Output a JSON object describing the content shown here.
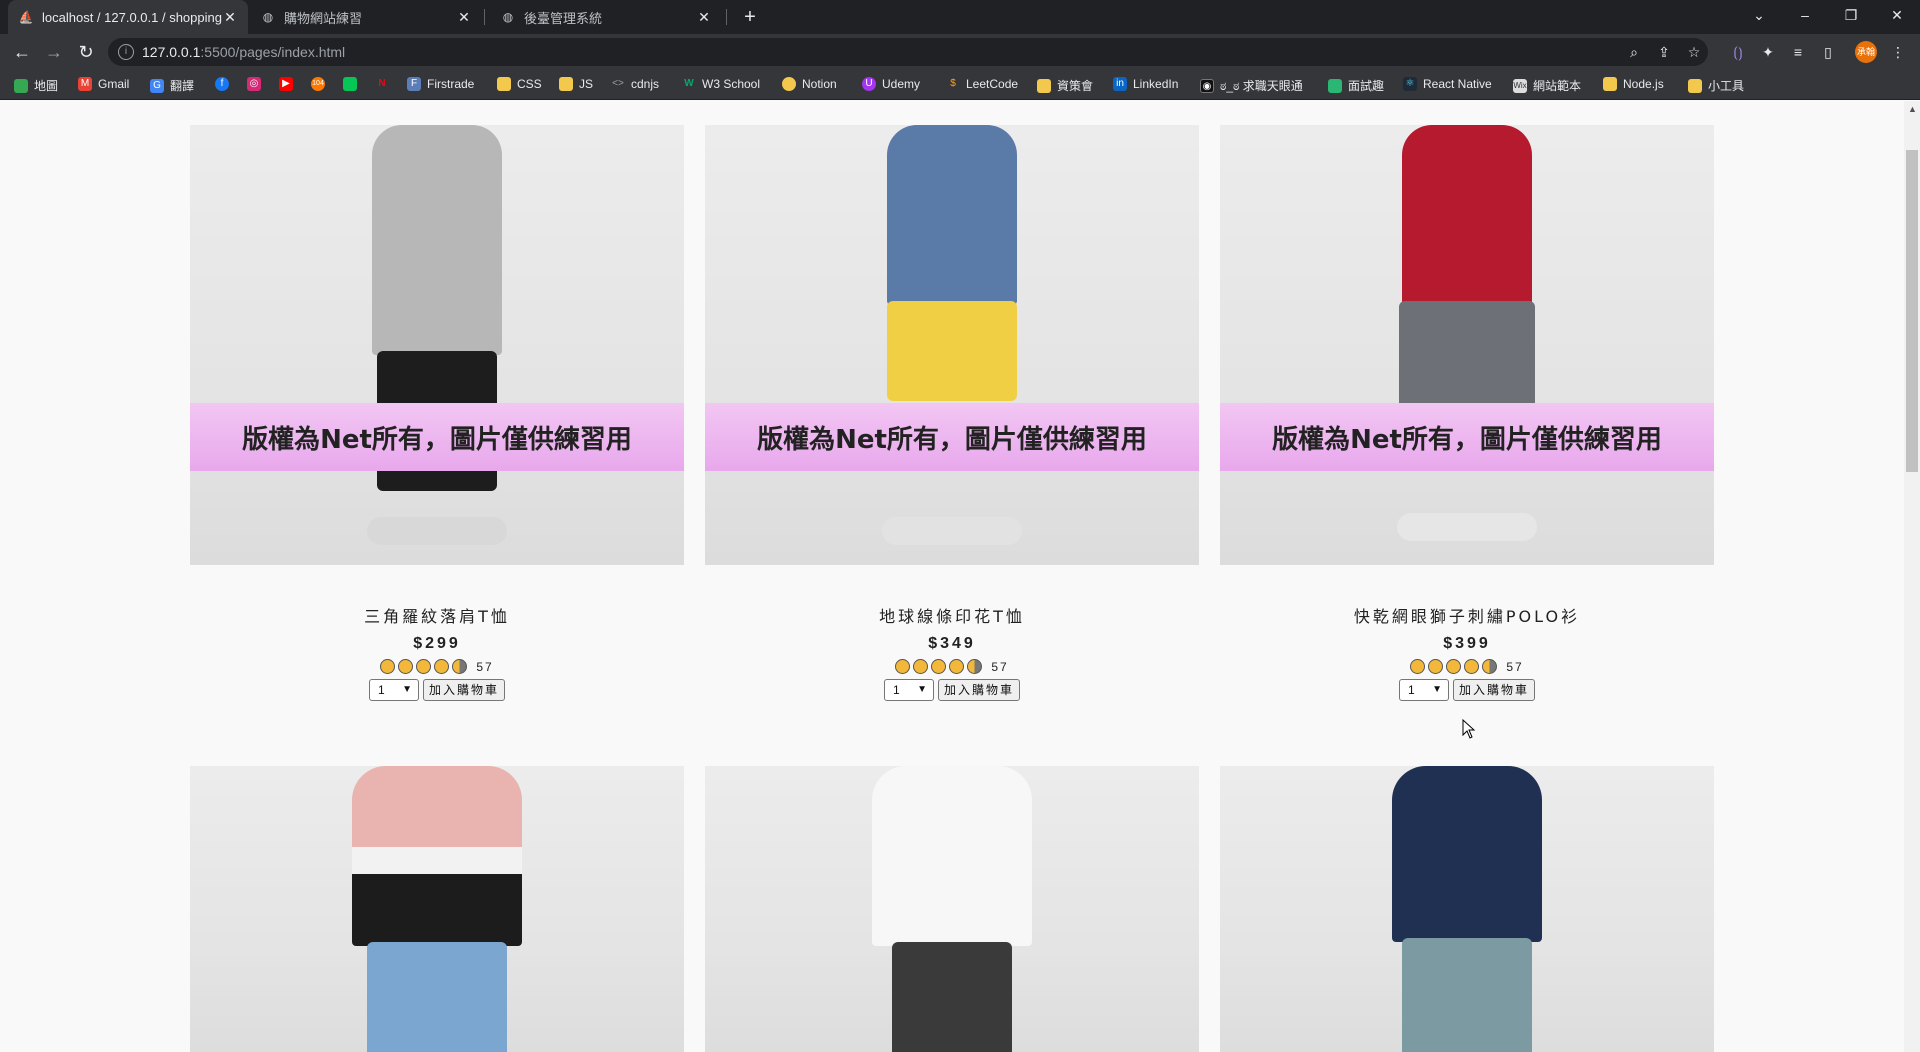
{
  "browser": {
    "tabs": [
      {
        "title": "localhost / 127.0.0.1 / shopping",
        "active": true
      },
      {
        "title": "購物網站練習",
        "active": false
      },
      {
        "title": "後臺管理系統",
        "active": false
      }
    ],
    "close_glyph": "✕",
    "new_tab_glyph": "+",
    "url_host": "127.0.0.1",
    "url_path": ":5500/pages/index.html",
    "profile_label": "承翰"
  },
  "bookmarks": [
    {
      "label": "地圖",
      "icon": "maps-icon",
      "color": "#34a853"
    },
    {
      "label": "Gmail",
      "icon": "gmail-icon",
      "color": "#ea4335"
    },
    {
      "label": "翻譯",
      "icon": "translate-icon",
      "color": "#4285f4"
    },
    {
      "label": "",
      "icon": "facebook-icon",
      "color": "#1877f2"
    },
    {
      "label": "",
      "icon": "instagram-icon",
      "color": "#d62976"
    },
    {
      "label": "",
      "icon": "youtube-icon",
      "color": "#ff0000"
    },
    {
      "label": "",
      "icon": "104-icon",
      "color": "#ff7800"
    },
    {
      "label": "",
      "icon": "line-icon",
      "color": "#06c755"
    },
    {
      "label": "",
      "icon": "netflix-icon",
      "color": "#e50914"
    },
    {
      "label": "Firstrade",
      "icon": "firstrade-icon",
      "color": "#5b7db8"
    },
    {
      "label": "CSS",
      "icon": "folder-icon",
      "color": "#f2c94c"
    },
    {
      "label": "JS",
      "icon": "folder-icon",
      "color": "#f2c94c"
    },
    {
      "label": "cdnjs",
      "icon": "code-icon",
      "color": "#9aa0a6"
    },
    {
      "label": "W3 School",
      "icon": "w3-icon",
      "color": "#04aa6d"
    },
    {
      "label": "Notion",
      "icon": "notion-icon",
      "color": "#f2c94c"
    },
    {
      "label": "Udemy",
      "icon": "udemy-icon",
      "color": "#a435f0"
    },
    {
      "label": "LeetCode",
      "icon": "leetcode-icon",
      "color": "#ffa116"
    },
    {
      "label": "資策會",
      "icon": "folder-icon",
      "color": "#f2c94c"
    },
    {
      "label": "LinkedIn",
      "icon": "linkedin-icon",
      "color": "#0a66c2"
    },
    {
      "label": "ಠ_ಠ 求職天眼通",
      "icon": "eye-icon",
      "color": "#333333"
    },
    {
      "label": "面試趣",
      "icon": "interview-icon",
      "color": "#2bb673"
    },
    {
      "label": "React Native",
      "icon": "react-icon",
      "color": "#61dafb"
    },
    {
      "label": "網站範本",
      "icon": "template-icon",
      "color": "#555555"
    },
    {
      "label": "Node.js",
      "icon": "folder-icon",
      "color": "#f2c94c"
    },
    {
      "label": "小工具",
      "icon": "folder-icon",
      "color": "#f2c94c"
    }
  ],
  "products": [
    {
      "name": "三角羅紋落肩T恤",
      "price": "$299",
      "rating": 4.5,
      "reviews": "57",
      "qty": "1",
      "button": "加入購物車",
      "banner": "版權為Net所有，圖片僅供練習用",
      "shirt_color": "#b7b7b7",
      "bottom_color": "#1d1d1d"
    },
    {
      "name": "地球線條印花T恤",
      "price": "$349",
      "rating": 4.5,
      "reviews": "57",
      "qty": "1",
      "button": "加入購物車",
      "banner": "版權為Net所有，圖片僅供練習用",
      "shirt_color": "#5a7aa8",
      "bottom_color": "#f0cf45"
    },
    {
      "name": "快乾網眼獅子刺繡POLO衫",
      "price": "$399",
      "rating": 4.5,
      "reviews": "57",
      "qty": "1",
      "button": "加入購物車",
      "banner": "版權為Net所有，圖片僅供練習用",
      "shirt_color": "#b51a2e",
      "bottom_color": "#6e7078"
    },
    {
      "shirt_color": "#e9b3b0",
      "shirt_color_2": "#1c1c1c",
      "bottom_color": "#7ba6cf"
    },
    {
      "shirt_color": "#f7f7f7",
      "bottom_color": "#3a3a3a"
    },
    {
      "shirt_color": "#1f3052",
      "bottom_color": "#7b9aa2"
    }
  ]
}
